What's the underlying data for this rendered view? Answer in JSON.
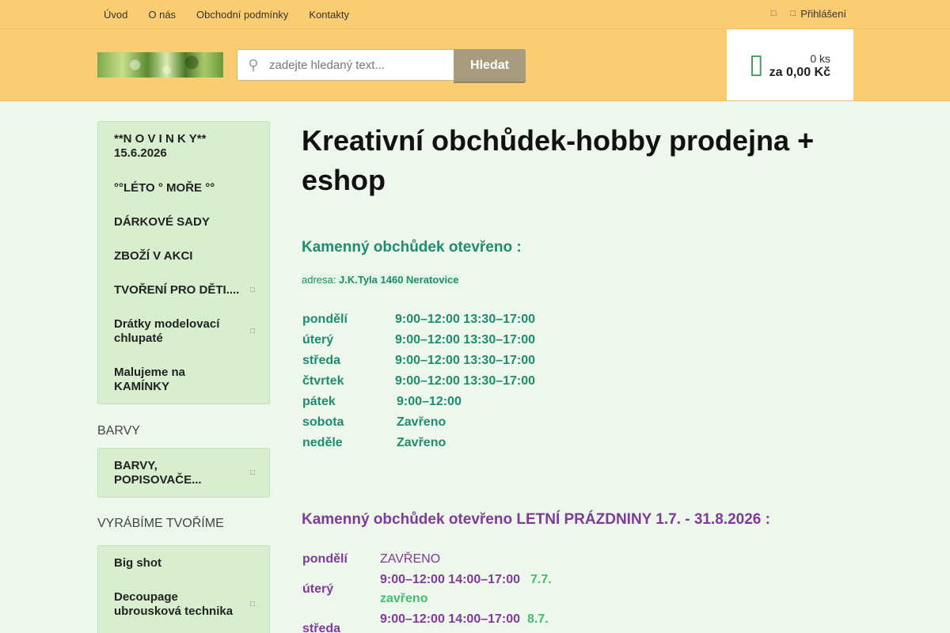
{
  "topnav": {
    "items": [
      "Úvod",
      "O nás",
      "Obchodní podmínky",
      "Kontakty"
    ],
    "login": "Přihlášení",
    "search_icon": "search-icon",
    "user_icon": "user-icon"
  },
  "header": {
    "search_placeholder": "zadejte hledaný text...",
    "search_button": "Hledat",
    "cart_qty": "0 ks",
    "cart_price": "za 0,00 Kč",
    "cart_icon": "cart-icon"
  },
  "sidebar": {
    "menu1": [
      "**N O V I N K Y** 15.6.2026",
      "°°LÉTO ° MOŘE °°",
      "DÁRKOVÉ SADY",
      "ZBOŽÍ V AKCI",
      "TVOŘENÍ PRO DĚTI....",
      "Drátky modelovací chlupaté",
      "Malujeme na KAMÍNKY"
    ],
    "heading2": "BARVY",
    "menu2": [
      "BARVY, POPISOVAČE..."
    ],
    "heading3": "VYRÁBÍME TVOŘÍME",
    "menu3": [
      "Big shot",
      "Decoupage ubrousková technika"
    ]
  },
  "main": {
    "title": "Kreativní obchůdek-hobby prodejna + eshop",
    "store_heading": "Kamenný obchůdek otevřeno  :",
    "address_label": "adresa:",
    "address_value": "J.K.Tyla 1460 Neratovice",
    "schedule": [
      {
        "day": "pondělí",
        "time": "9:00–12:00 13:30–17:00"
      },
      {
        "day": "úterý",
        "time": "9:00–12:00 13:30–17:00"
      },
      {
        "day": "středa",
        "time": "9:00–12:00 13:30–17:00"
      },
      {
        "day": "čtvrtek",
        "time": "9:00–12:00 13:30–17:00"
      },
      {
        "day": "pátek",
        "time": "9:00–12:00"
      },
      {
        "day": "sobota",
        "time": "Zavřeno"
      },
      {
        "day": "neděle",
        "time": "Zavřeno"
      }
    ],
    "summer_heading": "Kamenný obchůdek otevřeno LETNÍ PRÁZDNINY 1.7. - 31.8.2026 :",
    "summer": [
      {
        "day": "pondělí",
        "time": "ZAVŘENO",
        "note": ""
      },
      {
        "day": "úterý",
        "time": "9:00–12:00 14:00–17:00",
        "note": "7.7.",
        "note2": "zavřeno"
      },
      {
        "day": "středa",
        "time": "9:00–12:00 14:00–17:00",
        "note": "8.7."
      }
    ]
  },
  "colors": {
    "topbar": "#fbcd72",
    "accent_green": "#1e8c6e",
    "accent_purple": "#7f3a9a",
    "menu_bg": "#d7efce"
  }
}
